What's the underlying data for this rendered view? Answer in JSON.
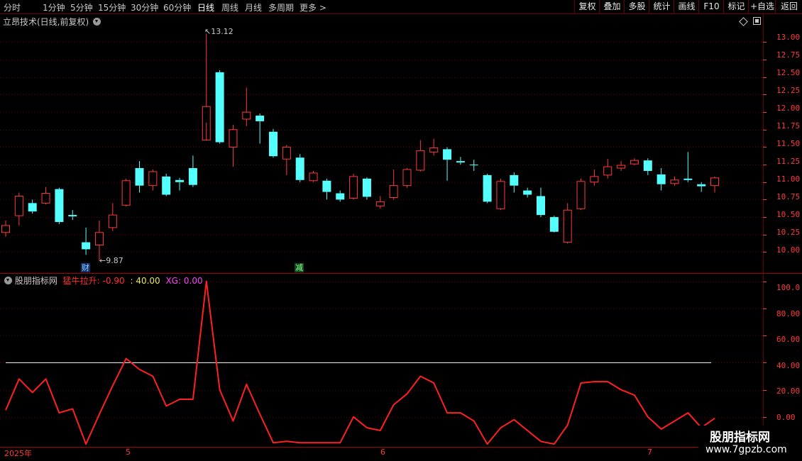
{
  "toolbar": {
    "periods": [
      "分时",
      "1分钟",
      "5分钟",
      "15分钟",
      "30分钟",
      "60分钟",
      "日线",
      "周线",
      "月线",
      "多周期",
      "更多"
    ],
    "active_period": "日线",
    "tools": [
      "复权",
      "叠加",
      "多股",
      "统计",
      "画线",
      "F10",
      "标记",
      "+自选",
      "返回"
    ]
  },
  "main_panel": {
    "title": "立昂技术(日线,前复权)",
    "high_marker": "13.12",
    "low_marker": "9.87",
    "badge_cai": "财",
    "badge_jian": "减",
    "y_ticks": [
      "13.00",
      "12.75",
      "12.50",
      "12.25",
      "12.00",
      "11.75",
      "11.50",
      "11.25",
      "11.00",
      "10.75",
      "10.50",
      "10.25",
      "10.00"
    ]
  },
  "indicator_panel": {
    "name": "股朋指标网",
    "series_label": "猛牛拉升:",
    "series_value": "-0.90",
    "line_sep": ":",
    "line_value": "40.00",
    "xg_label": "XG:",
    "xg_value": "0.00",
    "y_ticks": [
      "100.0",
      "80.00",
      "60.00",
      "40.00",
      "20.00",
      "0.00"
    ]
  },
  "x_axis": {
    "labels": [
      "2025年",
      "5",
      "6",
      "7"
    ]
  },
  "watermark": {
    "title": "股朋指标网",
    "url": "www.7gpzb.com"
  },
  "colors": {
    "up": "#ff3a3a",
    "down": "#54ffff",
    "indicator": "#ff2020",
    "level_line": "#ffffff",
    "grid": "#6b0000"
  },
  "chart_data": [
    {
      "type": "candlestick",
      "title": "立昂技术(日线,前复权)",
      "ylim": [
        9.7,
        13.4
      ],
      "fields": [
        "open",
        "close",
        "high",
        "low"
      ],
      "candles": [
        [
          10.28,
          10.38,
          10.45,
          10.22
        ],
        [
          10.52,
          10.8,
          10.85,
          10.38
        ],
        [
          10.7,
          10.58,
          10.75,
          10.55
        ],
        [
          10.7,
          10.84,
          10.93,
          10.68
        ],
        [
          10.9,
          10.43,
          10.92,
          10.4
        ],
        [
          10.53,
          10.51,
          10.6,
          10.46
        ],
        [
          10.14,
          10.04,
          10.35,
          9.96
        ],
        [
          10.1,
          10.28,
          10.45,
          9.87
        ],
        [
          10.35,
          10.53,
          10.7,
          10.3
        ],
        [
          10.67,
          11.02,
          11.05,
          10.65
        ],
        [
          11.2,
          10.95,
          11.3,
          10.85
        ],
        [
          10.95,
          11.15,
          11.18,
          10.88
        ],
        [
          11.08,
          10.82,
          11.12,
          10.8
        ],
        [
          11.03,
          11.0,
          11.06,
          10.88
        ],
        [
          11.2,
          10.96,
          11.38,
          10.93
        ],
        [
          11.6,
          12.08,
          13.12,
          11.85
        ],
        [
          12.57,
          11.57,
          12.6,
          11.55
        ],
        [
          11.5,
          11.75,
          11.82,
          11.22
        ],
        [
          11.9,
          12.0,
          12.35,
          11.8
        ],
        [
          11.95,
          11.87,
          11.98,
          11.55
        ],
        [
          11.72,
          11.37,
          11.76,
          11.35
        ],
        [
          11.33,
          11.5,
          11.53,
          11.1
        ],
        [
          11.35,
          11.03,
          11.4,
          11.0
        ],
        [
          11.02,
          11.13,
          11.16,
          11.0
        ],
        [
          11.02,
          10.86,
          11.05,
          10.75
        ],
        [
          10.84,
          10.75,
          10.88,
          10.72
        ],
        [
          10.77,
          11.08,
          11.12,
          10.75
        ],
        [
          11.05,
          10.79,
          11.07,
          10.75
        ],
        [
          10.66,
          10.72,
          10.8,
          10.62
        ],
        [
          10.78,
          10.95,
          11.18,
          10.75
        ],
        [
          10.95,
          11.18,
          11.2,
          10.92
        ],
        [
          11.17,
          11.45,
          11.6,
          11.15
        ],
        [
          11.43,
          11.49,
          11.62,
          11.38
        ],
        [
          11.47,
          11.32,
          11.5,
          11.02
        ],
        [
          11.3,
          11.28,
          11.36,
          11.25
        ],
        [
          11.25,
          11.24,
          11.32,
          11.16
        ],
        [
          11.1,
          10.72,
          11.12,
          10.7
        ],
        [
          10.62,
          11.01,
          11.05,
          10.6
        ],
        [
          11.1,
          10.95,
          11.14,
          10.85
        ],
        [
          10.88,
          10.82,
          10.92,
          10.78
        ],
        [
          10.8,
          10.53,
          10.92,
          10.5
        ],
        [
          10.5,
          10.29,
          10.52,
          10.28
        ],
        [
          10.14,
          10.6,
          10.7,
          10.12
        ],
        [
          10.62,
          11.01,
          11.05,
          10.6
        ],
        [
          11.0,
          11.08,
          11.18,
          10.95
        ],
        [
          11.1,
          11.22,
          11.33,
          11.05
        ],
        [
          11.2,
          11.24,
          11.3,
          11.16
        ],
        [
          11.26,
          11.31,
          11.34,
          11.24
        ],
        [
          11.31,
          11.16,
          11.34,
          11.1
        ],
        [
          11.11,
          10.97,
          11.2,
          10.88
        ],
        [
          10.98,
          11.03,
          11.08,
          10.95
        ],
        [
          11.05,
          11.03,
          11.43,
          11.0
        ],
        [
          10.97,
          10.94,
          11.0,
          10.86
        ],
        [
          10.95,
          11.06,
          11.08,
          10.85
        ]
      ]
    },
    {
      "type": "line",
      "title": "股朋指标网",
      "ylim": [
        -21,
        105
      ],
      "series": [
        {
          "name": "猛牛拉升",
          "values": [
            5,
            28,
            18,
            28,
            3,
            6,
            -20,
            2,
            23,
            43,
            35,
            30,
            8,
            13,
            13,
            100,
            20,
            -3,
            24,
            2,
            -19,
            -18,
            -19,
            -19,
            -19,
            -19,
            0,
            -8,
            -10,
            9,
            17,
            30,
            25,
            3,
            3,
            -3,
            -20,
            -8,
            -2,
            -10,
            -18,
            -20,
            -6,
            25,
            26,
            26,
            20,
            16,
            0,
            -9,
            -3,
            3,
            -8,
            -1
          ]
        },
        {
          "name": "",
          "values": [
            40
          ]
        },
        {
          "name": "XG",
          "values": [
            0
          ]
        }
      ]
    }
  ]
}
